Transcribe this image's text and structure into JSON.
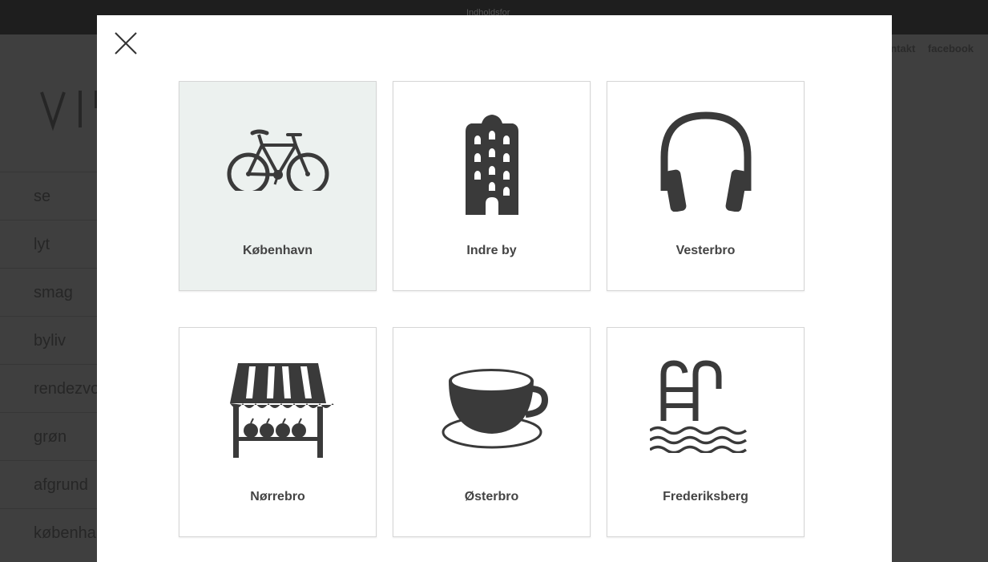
{
  "topbar": {
    "label": "Indholdsfor"
  },
  "header_links": [
    "ntakt",
    "facebook"
  ],
  "nav_items": [
    "se",
    "lyt",
    "smag",
    "byliv",
    "rendezvo",
    "grøn",
    "afgrund",
    "københa"
  ],
  "modal": {
    "close_icon": "close-icon",
    "tiles": [
      {
        "label": "København",
        "icon": "bicycle-icon",
        "active": true
      },
      {
        "label": "Indre by",
        "icon": "building-icon",
        "active": false
      },
      {
        "label": "Vesterbro",
        "icon": "headphones-icon",
        "active": false
      },
      {
        "label": "Nørrebro",
        "icon": "market-stall-icon",
        "active": false
      },
      {
        "label": "Østerbro",
        "icon": "coffee-cup-icon",
        "active": false
      },
      {
        "label": "Frederiksberg",
        "icon": "swimming-pool-icon",
        "active": false
      }
    ]
  },
  "colors": {
    "icon": "#3a3a3a",
    "active_tile": "#ecf1ef",
    "overlay": "#3f3f3f"
  }
}
